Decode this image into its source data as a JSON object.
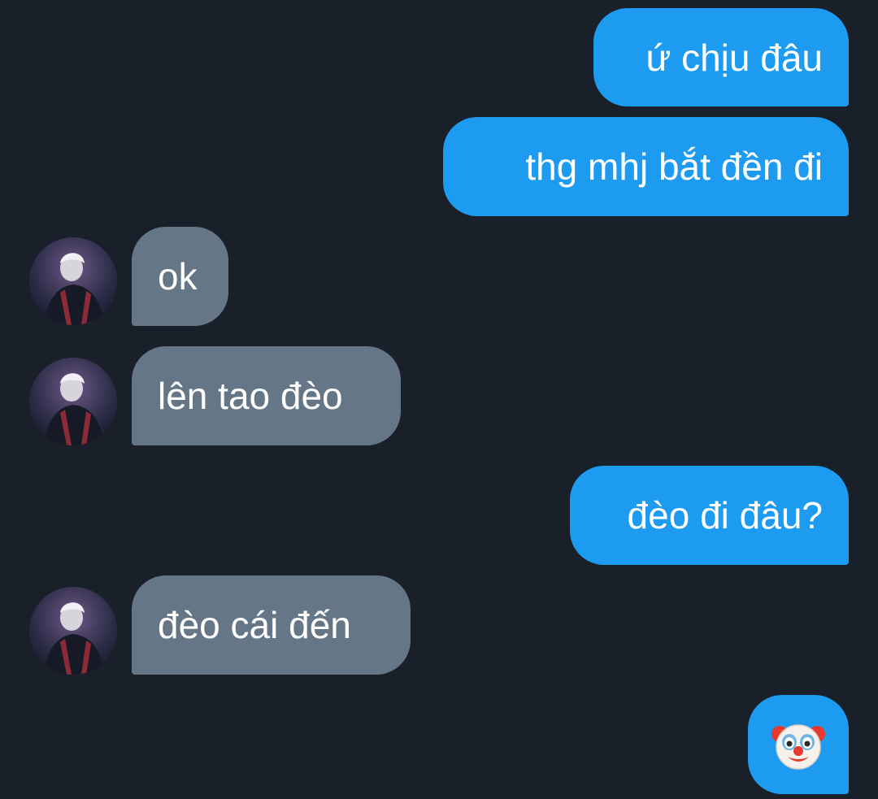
{
  "messages": [
    {
      "side": "out",
      "text": "ứ chịu đâu"
    },
    {
      "side": "out",
      "text": "thg mhj bắt đền đi"
    },
    {
      "side": "in",
      "text": "ok"
    },
    {
      "side": "in",
      "text": "lên tao đèo"
    },
    {
      "side": "out",
      "text": "đèo đi đâu?"
    },
    {
      "side": "in",
      "text": "đèo cái đến"
    },
    {
      "side": "out",
      "emoji": "clown-face-icon"
    }
  ],
  "colors": {
    "background": "#19202a",
    "outgoing_bubble": "#1d9bf0",
    "incoming_bubble": "#657786",
    "text": "#ffffff"
  }
}
